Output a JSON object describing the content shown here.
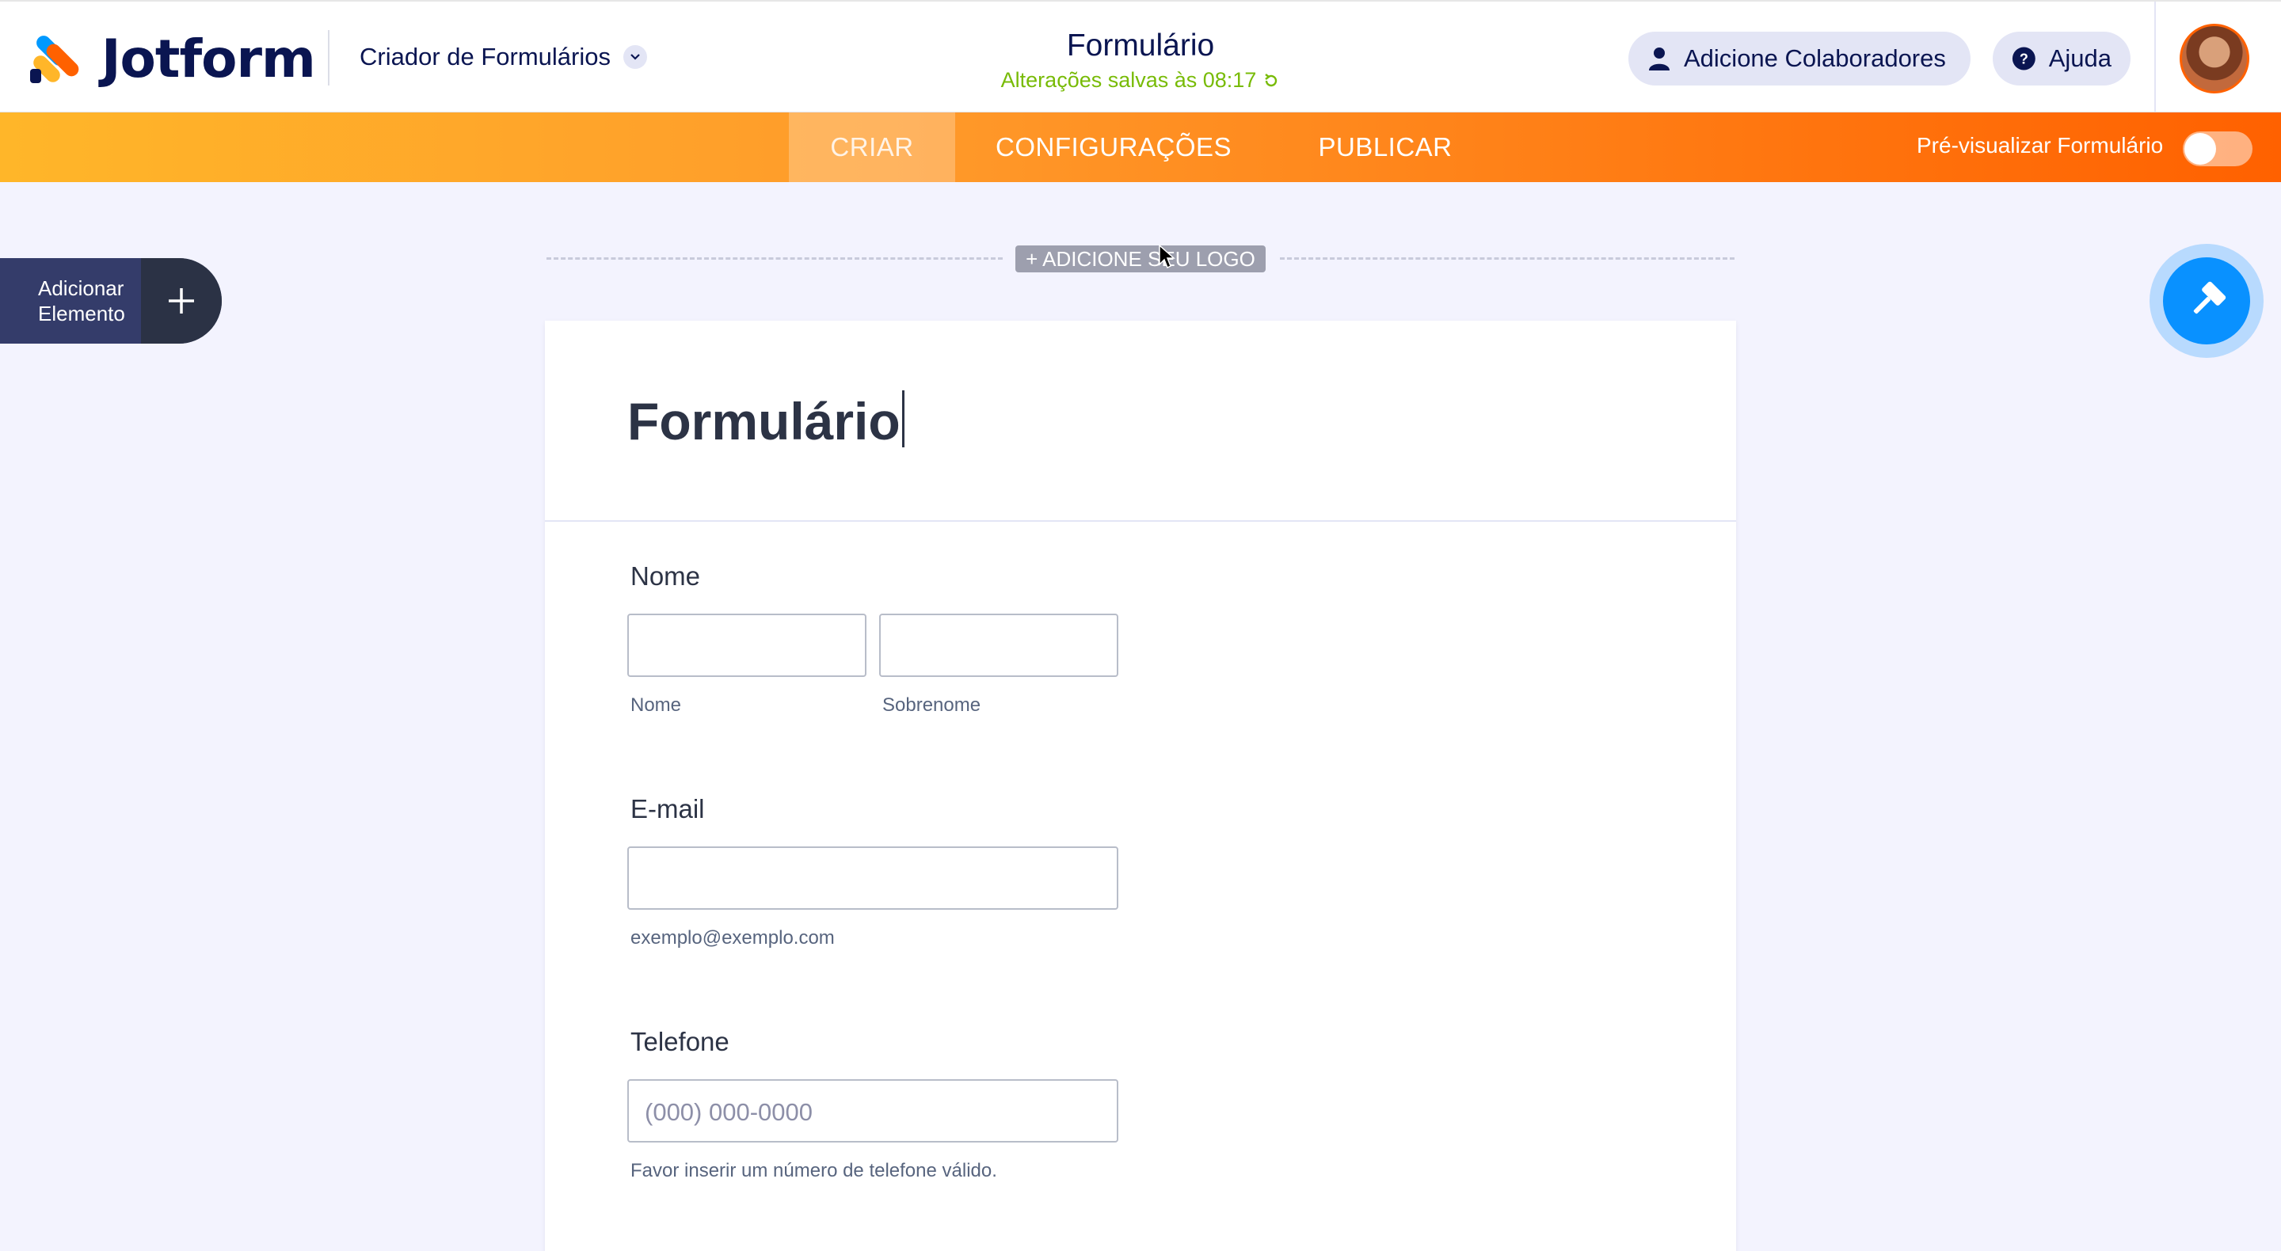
{
  "brand": {
    "name": "Jotform",
    "colors": {
      "orange": "#ff6100",
      "yellow": "#ffb629",
      "blue": "#0099ff",
      "navy": "#0a1551",
      "green": "#78bb07"
    }
  },
  "header": {
    "builder_title": "Criador de Formulários",
    "form_title": "Formulário",
    "save_status": "Alterações salvas às 08:17",
    "collaborators_button": "Adicione Colaboradores",
    "help_button": "Ajuda"
  },
  "tabs": [
    {
      "label": "CRIAR",
      "active": true
    },
    {
      "label": "CONFIGURAÇÕES",
      "active": false
    },
    {
      "label": "PUBLICAR",
      "active": false
    }
  ],
  "preview": {
    "label": "Pré-visualizar Formulário",
    "enabled": false
  },
  "add_element": {
    "line1": "Adicionar",
    "line2": "Elemento"
  },
  "logo_button": "+ ADICIONE SEU LOGO",
  "form": {
    "title": "Formulário",
    "fields": {
      "name": {
        "label": "Nome",
        "first_sub": "Nome",
        "last_sub": "Sobrenome",
        "first_value": "",
        "last_value": ""
      },
      "email": {
        "label": "E-mail",
        "sub": "exemplo@exemplo.com",
        "value": ""
      },
      "phone": {
        "label": "Telefone",
        "placeholder": "(000) 000-0000",
        "sub": "Favor inserir um número de telefone válido.",
        "value": ""
      }
    }
  },
  "icons": [
    "jotform-logo-icon",
    "chevron-down-icon",
    "refresh-icon",
    "user-icon",
    "help-icon",
    "plus-icon",
    "paint-roller-icon",
    "mouse-cursor-icon"
  ]
}
